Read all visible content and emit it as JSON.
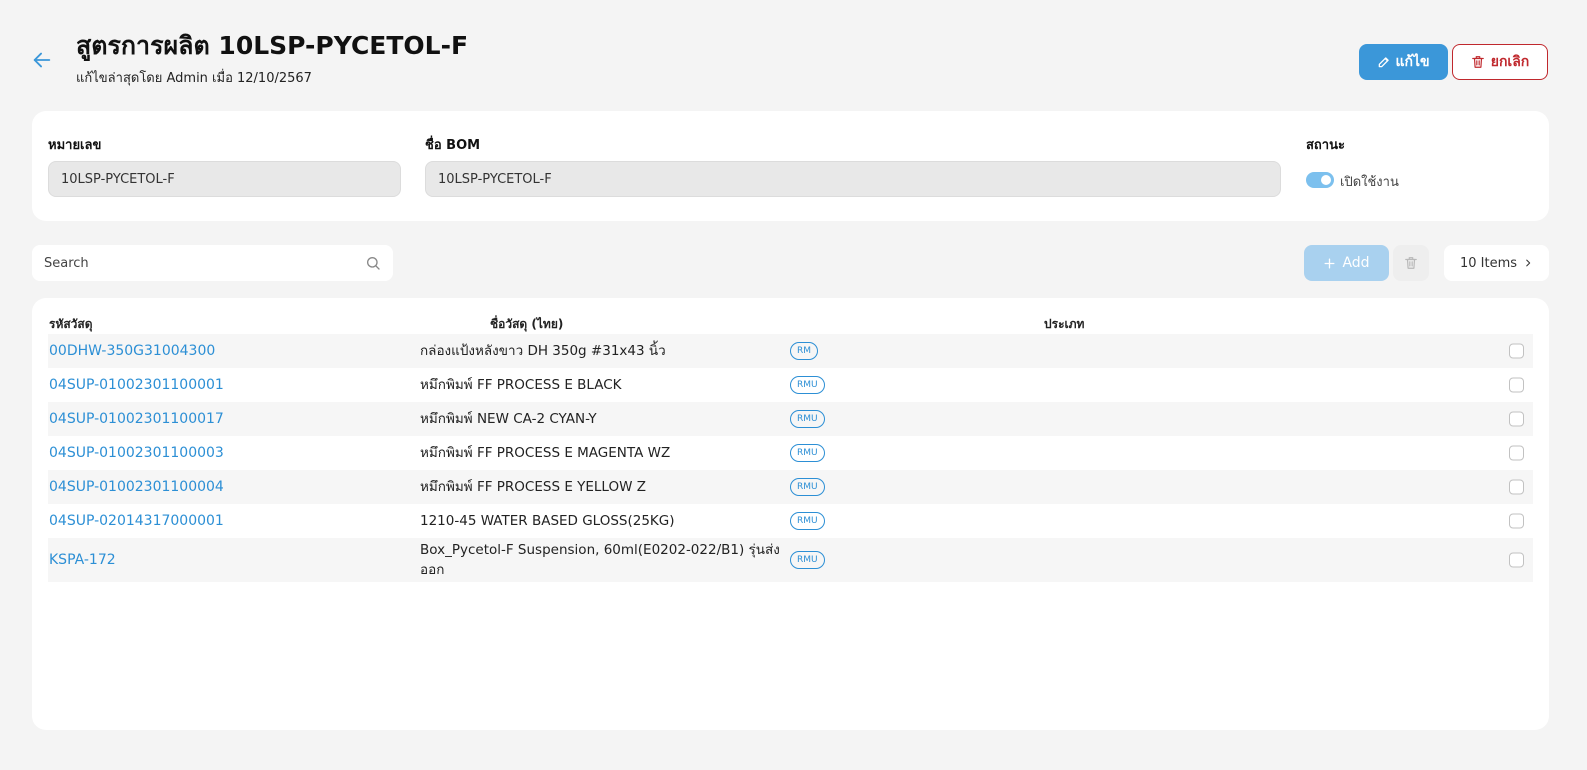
{
  "header": {
    "title": "สูตรการผลิต 10LSP-PYCETOL-F",
    "subtitle": "แก้ไขล่าสุดโดย Admin เมื่อ 12/10/2567",
    "edit_label": "แก้ไข",
    "cancel_label": "ยกเลิก"
  },
  "info": {
    "number_label": "หมายเลข",
    "number_value": "10LSP-PYCETOL-F",
    "bom_label": "ชื่อ BOM",
    "bom_value": "10LSP-PYCETOL-F",
    "status_label": "สถานะ",
    "status_value": "เปิดใช้งาน",
    "status_on": true
  },
  "toolbar": {
    "search_placeholder": "Search",
    "add_label": "Add",
    "items_label": "10 Items"
  },
  "table": {
    "columns": [
      "รหัสวัสดุ",
      "ชื่อวัสดุ (ไทย)",
      "ประเภท"
    ],
    "rows": [
      {
        "code": "00DHW-350G31004300",
        "name": "กล่องแป้งหลังขาว DH 350g #31x43 นิ้ว",
        "type": "RM"
      },
      {
        "code": "04SUP-01002301100001",
        "name": "หมึกพิมพ์ FF PROCESS E BLACK",
        "type": "RMU"
      },
      {
        "code": "04SUP-01002301100017",
        "name": "หมึกพิมพ์ NEW CA-2 CYAN-Y",
        "type": "RMU"
      },
      {
        "code": "04SUP-01002301100003",
        "name": "หมึกพิมพ์ FF PROCESS E MAGENTA WZ",
        "type": "RMU"
      },
      {
        "code": "04SUP-01002301100004",
        "name": "หมึกพิมพ์ FF PROCESS E YELLOW Z",
        "type": "RMU"
      },
      {
        "code": "04SUP-02014317000001",
        "name": "1210-45 WATER BASED GLOSS(25KG)",
        "type": "RMU"
      },
      {
        "code": "KSPA-172",
        "name": "Box_Pycetol-F Suspension, 60ml(E0202-022/B1) รุ่นส่งออก",
        "type": "RMU"
      }
    ]
  },
  "colors": {
    "primary": "#3b97d9",
    "danger": "#c0282d",
    "link": "#2c8fd5"
  }
}
